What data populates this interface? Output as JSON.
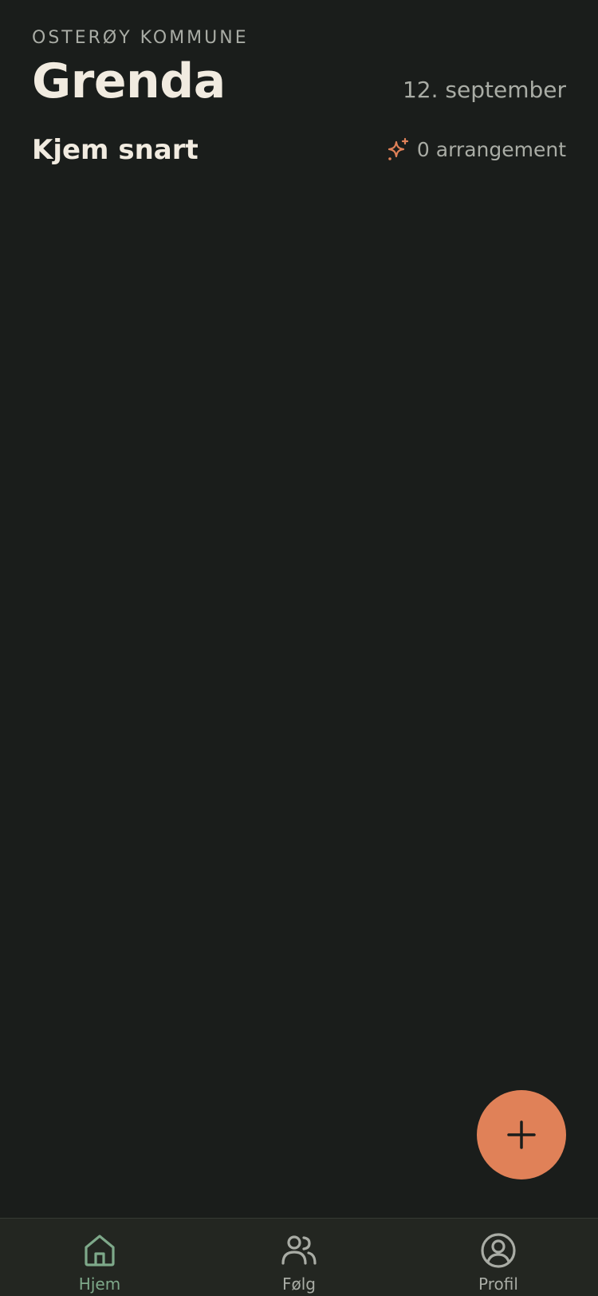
{
  "header": {
    "kommune": "OSTERØY KOMMUNE",
    "title": "Grenda",
    "date": "12. september"
  },
  "section": {
    "title": "Kjem snart",
    "event_count": "0 arrangement",
    "event_icon": "sparkle-icon"
  },
  "fab": {
    "icon": "plus-icon"
  },
  "nav": {
    "items": [
      {
        "label": "Hjem",
        "icon": "home-icon",
        "active": true
      },
      {
        "label": "Følg",
        "icon": "people-icon",
        "active": false
      },
      {
        "label": "Profil",
        "icon": "profile-icon",
        "active": false
      }
    ]
  },
  "colors": {
    "background": "#1a1d1b",
    "accent": "#e08158",
    "active_nav": "#7ea98a",
    "text_primary": "#f1ebe0",
    "text_secondary": "#a9aca5"
  }
}
